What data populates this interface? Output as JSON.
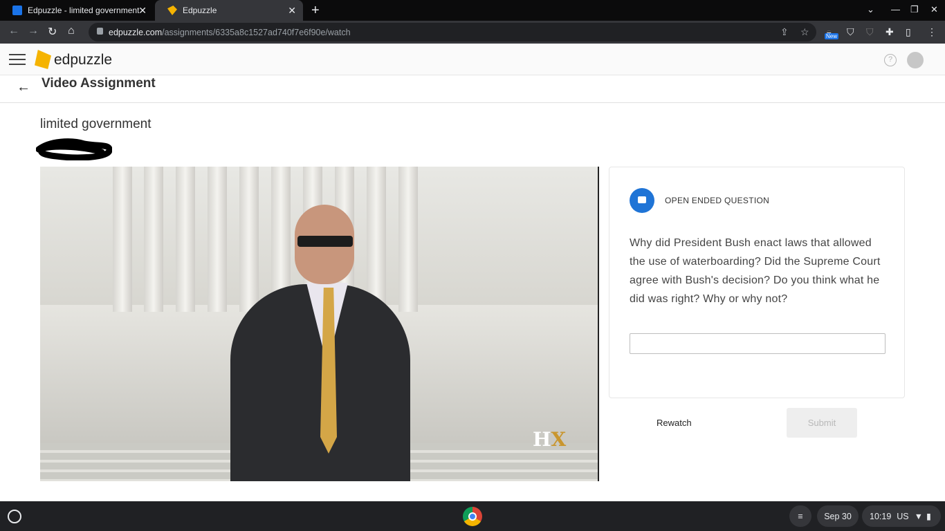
{
  "browser": {
    "tabs": [
      {
        "title": "Edpuzzle - limited government",
        "active": false
      },
      {
        "title": "Edpuzzle",
        "active": true
      }
    ],
    "url_domain": "edpuzzle.com",
    "url_path": "/assignments/6335a8c1527ad740f7e6f90e/watch",
    "extension_badge": "New"
  },
  "app": {
    "brand": "edpuzzle",
    "help_glyph": "?"
  },
  "page": {
    "back_glyph": "←",
    "title": "Video Assignment",
    "assignment_title": "limited government"
  },
  "video": {
    "watermark_h": "H",
    "watermark_x": "X"
  },
  "question": {
    "type_label": "OPEN ENDED QUESTION",
    "text": "Why did President Bush enact laws that allowed the use of waterboarding? Did the Supreme Court agree with Bush's decision? Do you think what he did was right? Why or why not?",
    "answer_value": ""
  },
  "actions": {
    "rewatch_label": "Rewatch",
    "submit_label": "Submit"
  },
  "shelf": {
    "date": "Sep 30",
    "time": "10:19",
    "locale": "US"
  },
  "colors": {
    "brand_yellow": "#f5b301",
    "question_blue": "#1f74d6"
  }
}
